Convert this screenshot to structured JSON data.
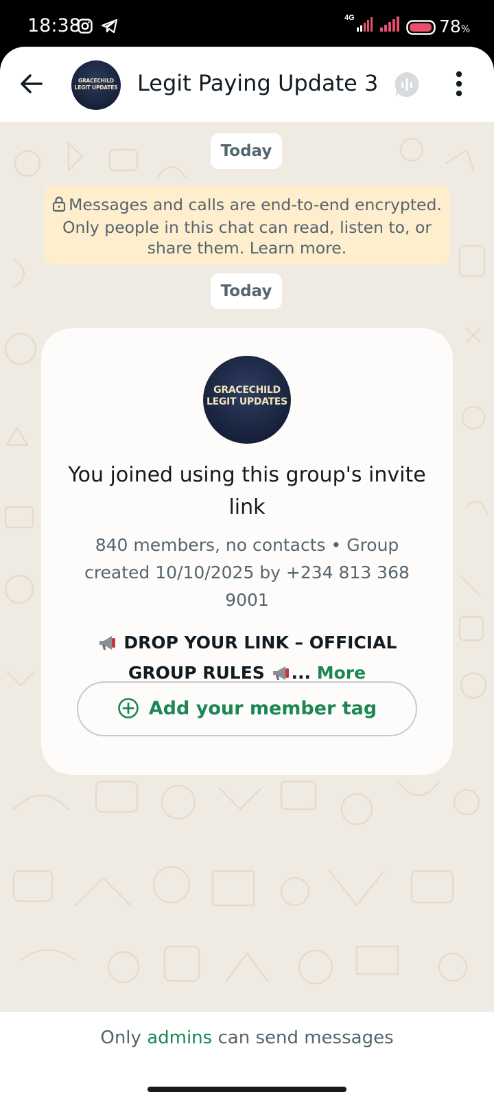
{
  "status_bar": {
    "time": "18:38",
    "network": "4G",
    "battery_percent": "78",
    "battery_unit": "%",
    "icons": [
      "instagram-icon",
      "telegram-icon",
      "signal-icon",
      "signal-icon",
      "battery-icon"
    ]
  },
  "header": {
    "title": "Legit Paying Update 3",
    "avatar_line1": "GRACECHILD",
    "avatar_line2": "LEGIT UPDATES",
    "icons": [
      "back-arrow-icon",
      "voice-chat-icon",
      "more-vert-icon"
    ]
  },
  "chat": {
    "date_chip_1": "Today",
    "encryption_notice": "Messages and calls are end-to-end encrypted. Only people in this chat can read, listen to, or share them. Learn more.",
    "date_chip_2": "Today",
    "join_card": {
      "avatar_line1": "GRACECHILD",
      "avatar_line2": "LEGIT UPDATES",
      "title": "You joined using this group's invite link",
      "subtitle": "840 members, no contacts • Group created 10/10/2025 by +234 813 368 9001",
      "description_start": "DROP YOUR LINK – OFFICIAL GROUP RULES",
      "description_ellipsis": "...",
      "more_label": "More",
      "add_tag_label": "Add your member tag"
    }
  },
  "bottom": {
    "prefix": "Only",
    "admins": "admins",
    "suffix": "can send messages"
  },
  "colors": {
    "accent_green": "#1b8755",
    "chat_background": "#efeae2",
    "encryption_bg": "#ffeecd",
    "text_primary": "#111b21",
    "text_secondary": "#54656f"
  }
}
